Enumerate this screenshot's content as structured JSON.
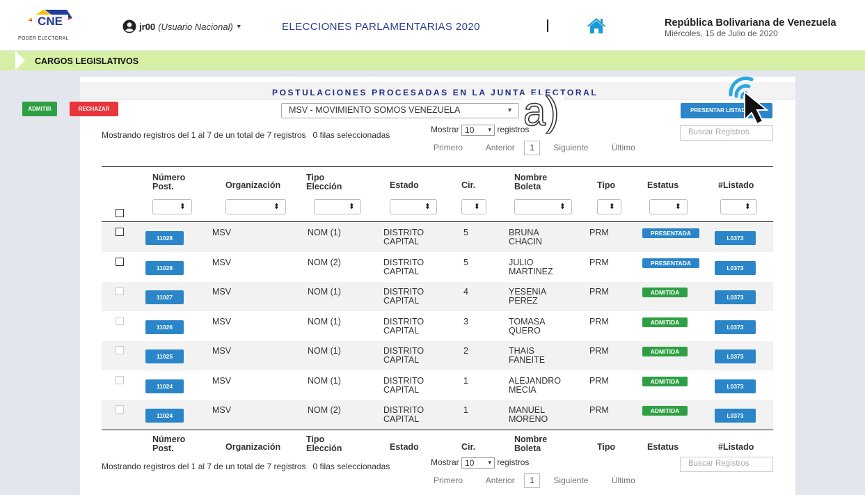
{
  "header": {
    "logo_text": "CNE",
    "logo_subtitle": "PODER ELECTORAL",
    "user_name": "jr00",
    "user_role": "(Usuario Nacional)",
    "user_caret": "▾",
    "election_title": "ELECCIONES PARLAMENTARIAS 2020",
    "country": "República Bolivariana de Venezuela",
    "date": "Miércoles, 15 de Julio de 2020"
  },
  "breadcrumb": {
    "label": "CARGOS LEGISLATIVOS"
  },
  "panel": {
    "title": "POSTULACIONES PROCESADAS EN LA JUNTA ELECTORAL",
    "admit_label": "ADMITIR",
    "reject_label": "RECHAZAR",
    "org_selected": "MSV - MOVIMIENTO SOMOS VENEZUELA",
    "present_label": "PRESENTAR LISTADO",
    "annotation": "a)"
  },
  "table_controls": {
    "info": "Mostrando registros del 1 al 7 de un total de 7 registros",
    "selected": "0 filas seleccionadas",
    "show_label": "Mostrar",
    "page_size": "10",
    "records_label": "registros",
    "search_placeholder": "Buscar Registros",
    "first": "Primero",
    "prev": "Anterior",
    "page": "1",
    "next": "Siguiente",
    "last": "Último"
  },
  "columns": {
    "num": "Número\nPost.",
    "org": "Organización",
    "tipo_elec": "Tipo\nElección",
    "estado": "Estado",
    "cir": "Cir.",
    "nombre": "Nombre\nBoleta",
    "tipo": "Tipo",
    "estatus": "Estatus",
    "listado": "#Listado"
  },
  "colors": {
    "presentada": "#2a86c8",
    "admitida": "#2ea043",
    "primary": "#2a86c8"
  },
  "rows": [
    {
      "num": "11028",
      "org": "MSV",
      "tipo_elec": "NOM (1)",
      "estado": "DISTRITO\nCAPITAL",
      "cir": "5",
      "nombre": "BRUNA\nCHACIN",
      "tipo": "PRM",
      "estatus": "PRESENTADA",
      "listado": "L0373"
    },
    {
      "num": "11028",
      "org": "MSV",
      "tipo_elec": "NOM (2)",
      "estado": "DISTRITO\nCAPITAL",
      "cir": "5",
      "nombre": "JULIO\nMARTINEZ",
      "tipo": "PRM",
      "estatus": "PRESENTADA",
      "listado": "L0373"
    },
    {
      "num": "11027",
      "org": "MSV",
      "tipo_elec": "NOM (1)",
      "estado": "DISTRITO\nCAPITAL",
      "cir": "4",
      "nombre": "YESENIA\nPEREZ",
      "tipo": "PRM",
      "estatus": "ADMITIDA",
      "listado": "L0373"
    },
    {
      "num": "11026",
      "org": "MSV",
      "tipo_elec": "NOM (1)",
      "estado": "DISTRITO\nCAPITAL",
      "cir": "3",
      "nombre": "TOMASA\nQUERO",
      "tipo": "PRM",
      "estatus": "ADMITIDA",
      "listado": "L0373"
    },
    {
      "num": "11025",
      "org": "MSV",
      "tipo_elec": "NOM (1)",
      "estado": "DISTRITO\nCAPITAL",
      "cir": "2",
      "nombre": "THAIS\nFANEITE",
      "tipo": "PRM",
      "estatus": "ADMITIDA",
      "listado": "L0373"
    },
    {
      "num": "11024",
      "org": "MSV",
      "tipo_elec": "NOM (1)",
      "estado": "DISTRITO\nCAPITAL",
      "cir": "1",
      "nombre": "ALEJANDRO\nMECIA",
      "tipo": "PRM",
      "estatus": "ADMITIDA",
      "listado": "L0373"
    },
    {
      "num": "11024",
      "org": "MSV",
      "tipo_elec": "NOM (2)",
      "estado": "DISTRITO\nCAPITAL",
      "cir": "1",
      "nombre": "MANUEL\nMORENO",
      "tipo": "PRM",
      "estatus": "ADMITIDA",
      "listado": "L0373"
    }
  ]
}
